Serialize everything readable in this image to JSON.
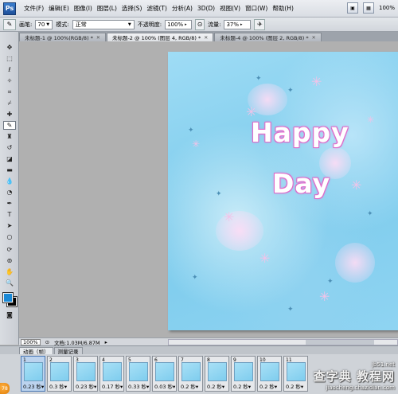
{
  "menubar": {
    "logo": "Ps",
    "items": [
      "文件(F)",
      "编辑(E)",
      "图像(I)",
      "图层(L)",
      "选择(S)",
      "滤镜(T)",
      "分析(A)",
      "3D(D)",
      "视图(V)",
      "窗口(W)",
      "帮助(H)"
    ],
    "zoom": "100%"
  },
  "options": {
    "brush_label": "画笔:",
    "brush_size": "70",
    "mode_label": "模式:",
    "mode_value": "正常",
    "opacity_label": "不透明度:",
    "opacity_value": "100%",
    "flow_label": "流量:",
    "flow_value": "37%"
  },
  "tabs": [
    {
      "label": "未标题-1 @ 100%(RGB/8) *"
    },
    {
      "label": "未标题-2 @ 100% (图层 4, RGB/8) *"
    },
    {
      "label": "未标题-4 @ 100% (图层 2, RGB/8) *"
    }
  ],
  "canvas": {
    "line1": "Happy",
    "line2": "Day"
  },
  "status": {
    "zoom": "100%",
    "doc": "文档:1.03M/6.87M"
  },
  "animation": {
    "tabs": [
      "动画（帧）",
      "测量记录"
    ],
    "frames": [
      {
        "num": "1",
        "delay": "0.23 秒▾"
      },
      {
        "num": "2",
        "delay": "0.3 秒▾"
      },
      {
        "num": "3",
        "delay": "0.23 秒▾"
      },
      {
        "num": "4",
        "delay": "0.17 秒▾"
      },
      {
        "num": "5",
        "delay": "0.33 秒▾"
      },
      {
        "num": "6",
        "delay": "0.03 秒▾"
      },
      {
        "num": "7",
        "delay": "0.2 秒▾"
      },
      {
        "num": "8",
        "delay": "0.2 秒▾"
      },
      {
        "num": "9",
        "delay": "0.2 秒▾"
      },
      {
        "num": "10",
        "delay": "0.2 秒▾"
      },
      {
        "num": "11",
        "delay": "0.2 秒▾"
      }
    ],
    "badge": "78"
  },
  "watermark": {
    "line1": "查字典 教程网",
    "line2": "jiaocheng.chazidian.com",
    "site": "jb51.net"
  },
  "colors": {
    "foreground": "#1a89d6",
    "background": "#000000"
  }
}
